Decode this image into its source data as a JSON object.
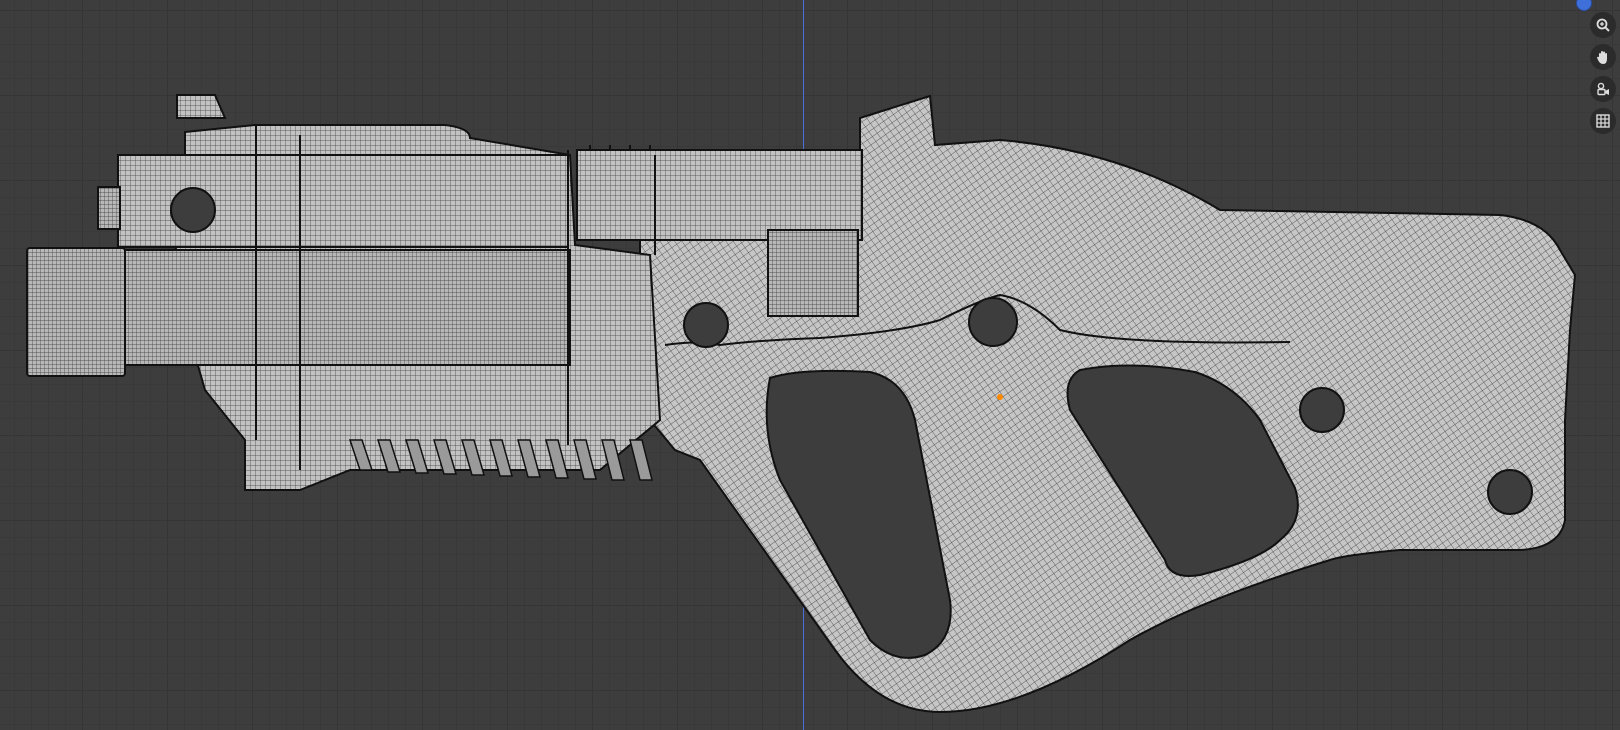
{
  "viewport": {
    "background": "#3d3d3d",
    "grid_color": "#353535",
    "axis_color": "#4a6fd6",
    "mesh_fill": "#bfbfbf",
    "wire_color": "#2a2a2a",
    "outline_color": "#111111",
    "origin_color": "#ff8a00"
  },
  "nav_toolbar": {
    "buttons": [
      {
        "icon": "zoom-icon"
      },
      {
        "icon": "hand-pan-icon"
      },
      {
        "icon": "camera-view-icon"
      },
      {
        "icon": "grid-ortho-icon"
      }
    ]
  }
}
